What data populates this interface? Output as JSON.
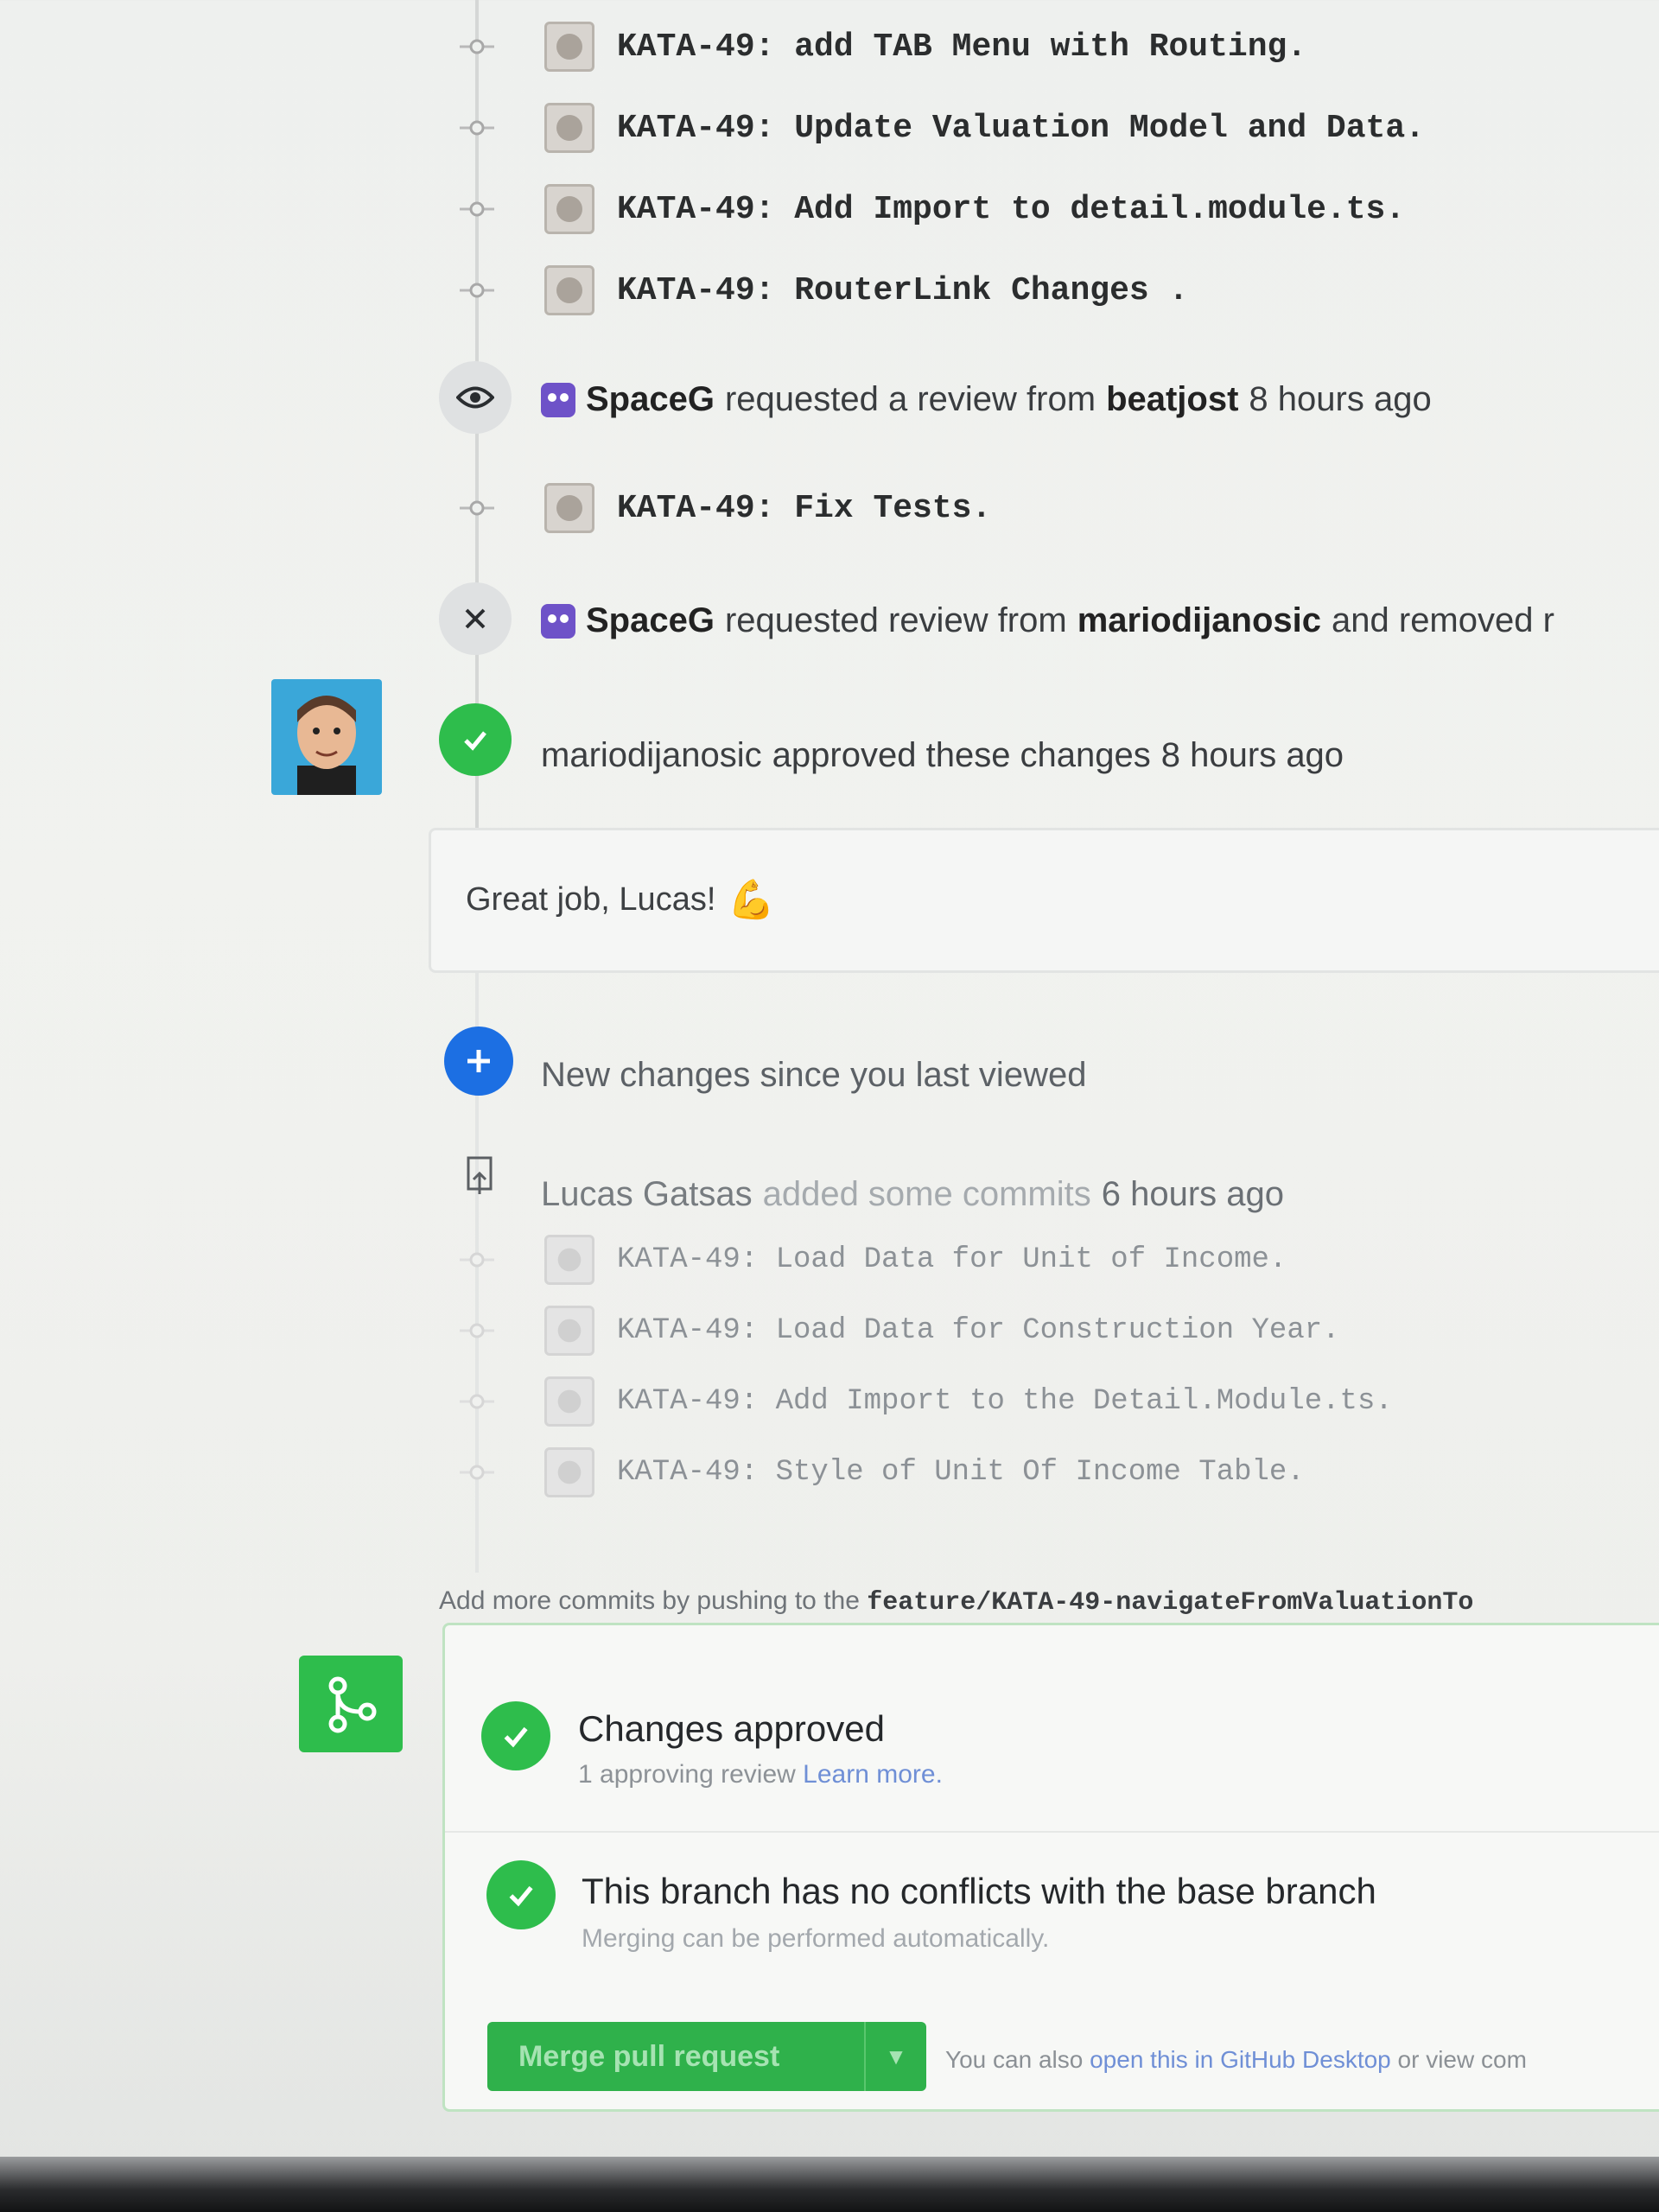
{
  "commits_top": [
    {
      "message": "KATA-49: add TAB Menu with Routing."
    },
    {
      "message": "KATA-49: Update Valuation Model and Data."
    },
    {
      "message": "KATA-49: Add Import to detail.module.ts."
    },
    {
      "message": "KATA-49: RouterLink Changes ."
    }
  ],
  "review_request": {
    "actor": "SpaceG",
    "text": "requested a review from",
    "reviewer": "beatjost",
    "time": "8 hours ago"
  },
  "commit_fix": {
    "message": "KATA-49: Fix Tests."
  },
  "review_change": {
    "actor": "SpaceG",
    "text": "requested review from",
    "reviewer": "mariodijanosic",
    "tail": "and removed r"
  },
  "approval": {
    "user": "mariodijanosic",
    "text": "approved these changes",
    "time": "8 hours ago",
    "comment": "Great job, Lucas!",
    "emoji": "💪"
  },
  "new_changes": {
    "label": "New changes since you last viewed"
  },
  "push_event": {
    "author": "Lucas Gatsas",
    "text": "added some commits",
    "time": "6 hours ago"
  },
  "commits_new": [
    {
      "message": "KATA-49: Load Data for Unit of Income."
    },
    {
      "message": "KATA-49: Load Data for Construction Year."
    },
    {
      "message": "KATA-49: Add Import to the Detail.Module.ts."
    },
    {
      "message": "KATA-49: Style of Unit Of Income Table."
    }
  ],
  "push_hint": {
    "prefix": "Add more commits by pushing to the",
    "branch": "feature/KATA-49-navigateFromValuationTo"
  },
  "merge": {
    "approved_title": "Changes approved",
    "approved_sub": "1 approving review",
    "learn_more": "Learn more.",
    "conflict_title": "This branch has no conflicts with the base branch",
    "conflict_sub": "Merging can be performed automatically.",
    "button": "Merge pull request",
    "alt_prefix": "You can also",
    "alt_link": "open this in GitHub Desktop",
    "alt_suffix": "or view com"
  },
  "colors": {
    "green": "#2ebd4c",
    "blue": "#1c6fe3",
    "purple": "#6e52c8"
  }
}
